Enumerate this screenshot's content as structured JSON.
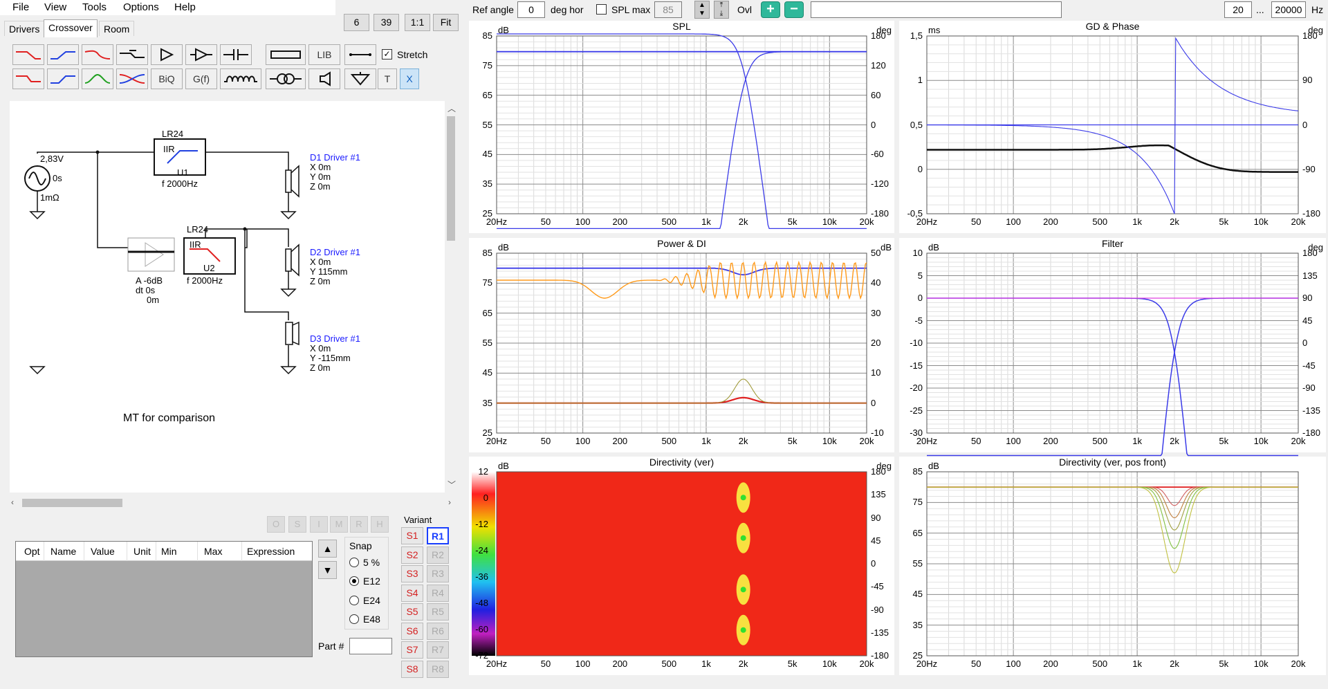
{
  "menu": {
    "file": "File",
    "view": "View",
    "tools": "Tools",
    "options": "Options",
    "help": "Help"
  },
  "tabs": {
    "drivers": "Drivers",
    "crossover": "Crossover",
    "room": "Room"
  },
  "zoom": {
    "a": "6",
    "b": "39",
    "c": "1:1",
    "d": "Fit"
  },
  "tools": {
    "stretch": "Stretch",
    "lib": "LIB",
    "biq": "BiQ",
    "gf": "G(f)",
    "t": "T",
    "x": "X"
  },
  "schematic": {
    "source_v": "2,83V",
    "source_t": "0s",
    "source_r": "1mΩ",
    "f1_title": "LR24",
    "f1_type": "IIR",
    "f1_name": "U1",
    "f1_freq": "f  2000Hz",
    "f2_title": "LR24",
    "f2_type": "IIR",
    "f2_name": "U2",
    "f2_freq": "f  2000Hz",
    "amp_a": "A  -6dB",
    "amp_dt": "dt 0s",
    "amp_d": "0m",
    "d1_name": "D1 Driver #1",
    "d1_x": "X 0m",
    "d1_y": "Y 0m",
    "d1_z": "Z 0m",
    "d2_name": "D2 Driver #1",
    "d2_x": "X 0m",
    "d2_y": "Y 115mm",
    "d2_z": "Z 0m",
    "d3_name": "D3 Driver #1",
    "d3_x": "X 0m",
    "d3_y": "Y -115mm",
    "d3_z": "Z 0m",
    "comment": "MT for comparison"
  },
  "ohb": [
    "O",
    "S",
    "I",
    "M",
    "R",
    "H"
  ],
  "opt_table": {
    "cols": [
      "Opt",
      "Name",
      "Value",
      "Unit",
      "Min",
      "Max",
      "Expression"
    ]
  },
  "snap": {
    "title": "Snap",
    "o1": "5 %",
    "o2": "E12",
    "o3": "E24",
    "o4": "E48",
    "selected": "E12"
  },
  "part_label": "Part #",
  "variant": {
    "title": "Variant",
    "s": [
      "S1",
      "S2",
      "S3",
      "S4",
      "S5",
      "S6",
      "S7",
      "S8"
    ],
    "r": [
      "R1",
      "R2",
      "R3",
      "R4",
      "R5",
      "R6",
      "R7",
      "R8"
    ],
    "selected": "R1"
  },
  "toolbar": {
    "ref_angle_label": "Ref angle",
    "ref_angle_value": "0",
    "deg_hor": "deg hor",
    "spl_max_label": "SPL max",
    "spl_max_value": "85",
    "ovl": "Ovl",
    "f_min": "20",
    "ellipsis": "...",
    "f_max": "20000",
    "hz": "Hz"
  },
  "x_ticks": [
    "20Hz",
    "50",
    "100",
    "200",
    "500",
    "1k",
    "2k",
    "5k",
    "10k",
    "20k"
  ],
  "charts": {
    "spl": {
      "title": "SPL",
      "left_unit": "dB",
      "right_unit": "deg",
      "left_ticks": [
        "85",
        "75",
        "65",
        "55",
        "45",
        "35",
        "25"
      ],
      "right_ticks": [
        "180",
        "120",
        "60",
        "0",
        "-60",
        "-120",
        "-180"
      ]
    },
    "gd": {
      "title": "GD & Phase",
      "left_unit": "ms",
      "right_unit": "deg",
      "left_ticks": [
        "1,5",
        "1",
        "0,5",
        "0",
        "-0,5"
      ],
      "right_ticks": [
        "180",
        "90",
        "0",
        "-90",
        "-180"
      ]
    },
    "power": {
      "title": "Power & DI",
      "left_unit": "dB",
      "right_unit": "dB",
      "left_ticks": [
        "85",
        "75",
        "65",
        "55",
        "45",
        "35",
        "25"
      ],
      "right_ticks": [
        "50",
        "40",
        "30",
        "20",
        "10",
        "0",
        "-10"
      ]
    },
    "filter": {
      "title": "Filter",
      "left_unit": "dB",
      "right_unit": "deg",
      "left_ticks": [
        "10",
        "5",
        "0",
        "-5",
        "-10",
        "-15",
        "-20",
        "-25",
        "-30"
      ],
      "right_ticks": [
        "180",
        "135",
        "90",
        "45",
        "0",
        "-45",
        "-90",
        "-135",
        "-180"
      ]
    },
    "dir": {
      "title": "Directivity (ver)",
      "left_unit": "dB",
      "right_unit": "deg",
      "left_ticks": [
        "12",
        "0",
        "-12",
        "-24",
        "-36",
        "-48",
        "-60",
        "-72"
      ],
      "right_ticks": [
        "180",
        "135",
        "90",
        "45",
        "0",
        "-45",
        "-90",
        "-135",
        "-180"
      ]
    },
    "dirpos": {
      "title": "Directivity (ver, pos front)",
      "left_unit": "dB",
      "right_unit": "",
      "left_ticks": [
        "85",
        "75",
        "65",
        "55",
        "45",
        "35",
        "25"
      ],
      "right_ticks": []
    }
  },
  "colors": {
    "blue": "#3a3ae8",
    "orange": "#ff9a1a",
    "red": "#e02020",
    "black": "#101010",
    "olive": "#a09a3a",
    "magenta": "#e040e0"
  },
  "chart_data": [
    {
      "type": "line",
      "title": "SPL",
      "xlabel": "",
      "ylabel": "dB",
      "x_scale": "log",
      "xlim": [
        20,
        20000
      ],
      "ylim": [
        25,
        85
      ],
      "series": [
        {
          "values_desc": []
        }
      ]
    }
  ]
}
